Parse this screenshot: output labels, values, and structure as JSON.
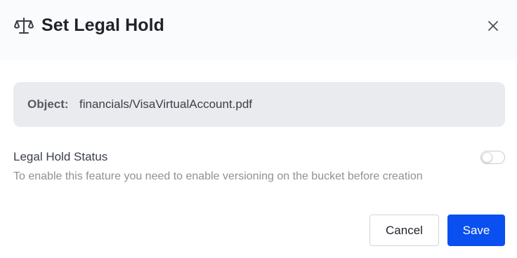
{
  "dialog": {
    "title": "Set Legal Hold",
    "title_icon": "scale-icon",
    "close_icon": "close-icon"
  },
  "object": {
    "label": "Object:",
    "value": "financials/VisaVirtualAccount.pdf"
  },
  "legal_hold": {
    "title": "Legal Hold Status",
    "hint": "To enable this feature you need to enable versioning on the bucket before creation",
    "enabled": false
  },
  "actions": {
    "cancel_label": "Cancel",
    "save_label": "Save"
  },
  "colors": {
    "primary": "#0a4ff0",
    "header_bg": "#fafbfd",
    "object_box_bg": "#eaebef"
  }
}
